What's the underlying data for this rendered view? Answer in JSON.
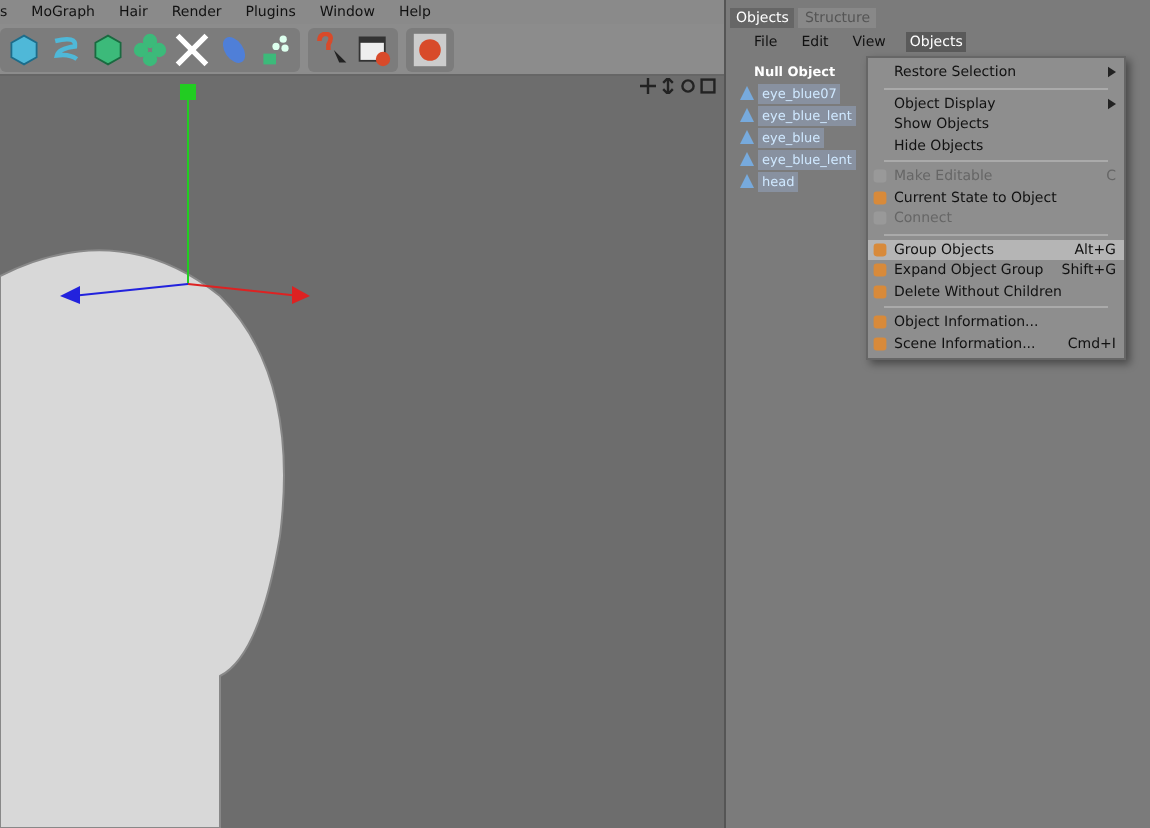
{
  "menubar": [
    {
      "label": "s"
    },
    {
      "label": "MoGraph"
    },
    {
      "label": "Hair"
    },
    {
      "label": "Render"
    },
    {
      "label": "Plugins"
    },
    {
      "label": "Window"
    },
    {
      "label": "Help"
    }
  ],
  "panel": {
    "tabs": [
      {
        "label": "Objects",
        "selected": true
      },
      {
        "label": "Structure",
        "selected": false
      }
    ],
    "menu": [
      {
        "label": "File",
        "selected": false
      },
      {
        "label": "Edit",
        "selected": false
      },
      {
        "label": "View",
        "selected": false
      },
      {
        "label": "Objects",
        "selected": true
      }
    ],
    "tree": [
      {
        "label": "Null Object",
        "selected": false,
        "children": [
          {
            "label": "eye_blue07",
            "selected": true
          },
          {
            "label": "eye_blue_lent",
            "selected": true
          },
          {
            "label": "eye_blue",
            "selected": true
          },
          {
            "label": "eye_blue_lent",
            "selected": true
          },
          {
            "label": "head",
            "selected": true
          }
        ]
      }
    ]
  },
  "dropdown": [
    {
      "kind": "item",
      "label": "Restore Selection",
      "submenu": true,
      "disabled": false,
      "selected": false,
      "icon": false
    },
    {
      "kind": "separator"
    },
    {
      "kind": "item",
      "label": "Object Display",
      "submenu": true,
      "disabled": false,
      "selected": false,
      "icon": false
    },
    {
      "kind": "item",
      "label": "Show Objects",
      "submenu": false,
      "disabled": false,
      "selected": false,
      "icon": false
    },
    {
      "kind": "item",
      "label": "Hide Objects",
      "submenu": false,
      "disabled": false,
      "selected": false,
      "icon": false
    },
    {
      "kind": "separator"
    },
    {
      "kind": "item",
      "label": "Make Editable",
      "shortcut": "C",
      "submenu": false,
      "disabled": true,
      "selected": false,
      "icon": true
    },
    {
      "kind": "item",
      "label": "Current State to Object",
      "submenu": false,
      "disabled": false,
      "selected": false,
      "icon": true
    },
    {
      "kind": "item",
      "label": "Connect",
      "submenu": false,
      "disabled": true,
      "selected": false,
      "icon": true
    },
    {
      "kind": "separator"
    },
    {
      "kind": "item",
      "label": "Group Objects",
      "shortcut": "Alt+G",
      "submenu": false,
      "disabled": false,
      "selected": true,
      "icon": true
    },
    {
      "kind": "item",
      "label": "Expand Object Group",
      "shortcut": "Shift+G",
      "submenu": false,
      "disabled": false,
      "selected": false,
      "icon": true
    },
    {
      "kind": "item",
      "label": "Delete Without Children",
      "submenu": false,
      "disabled": false,
      "selected": false,
      "icon": true
    },
    {
      "kind": "separator"
    },
    {
      "kind": "item",
      "label": "Object Information...",
      "submenu": false,
      "disabled": false,
      "selected": false,
      "icon": true
    },
    {
      "kind": "item",
      "label": "Scene Information...",
      "shortcut": "Cmd+I",
      "submenu": false,
      "disabled": false,
      "selected": false,
      "icon": true
    }
  ]
}
